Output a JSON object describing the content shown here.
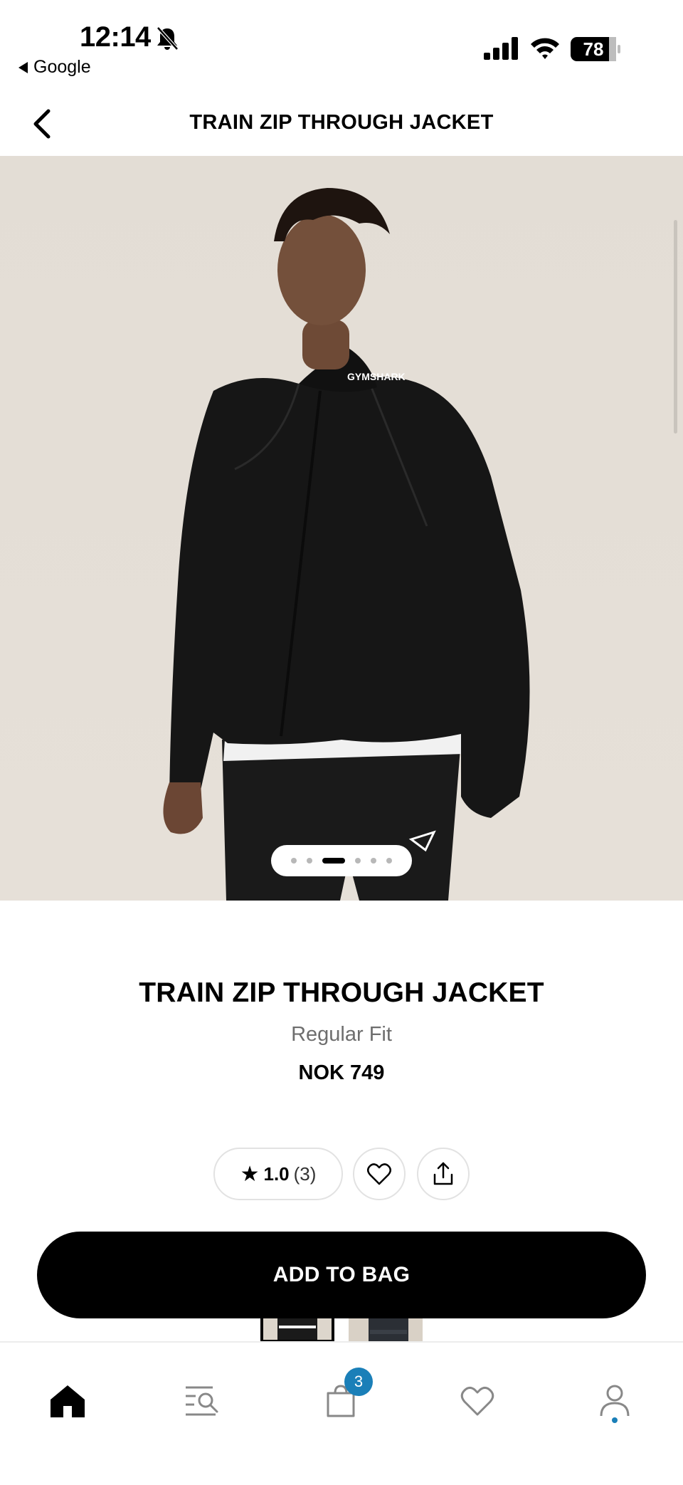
{
  "status_bar": {
    "time": "12:14",
    "back_app": "Google",
    "battery": "78"
  },
  "header": {
    "title": "TRAIN ZIP THROUGH JACKET"
  },
  "hero": {
    "brand_print": "GYMSHARK",
    "image_count": 6,
    "active_image": 3
  },
  "product": {
    "title": "TRAIN ZIP THROUGH JACKET",
    "fit": "Regular Fit",
    "price": "NOK 749"
  },
  "rating": {
    "value": "1.0",
    "count": "(3)"
  },
  "actions": {
    "add_to_bag": "ADD TO BAG"
  },
  "bottom_nav": {
    "items": [
      {
        "icon": "home-icon"
      },
      {
        "icon": "search-icon"
      },
      {
        "icon": "bag-icon"
      },
      {
        "icon": "heart-icon"
      },
      {
        "icon": "account-icon"
      }
    ],
    "bag_badge": "3"
  },
  "colors": {
    "accent": "#1a7fb8",
    "button_bg": "#000000",
    "image_bg": "#e4ded6"
  }
}
